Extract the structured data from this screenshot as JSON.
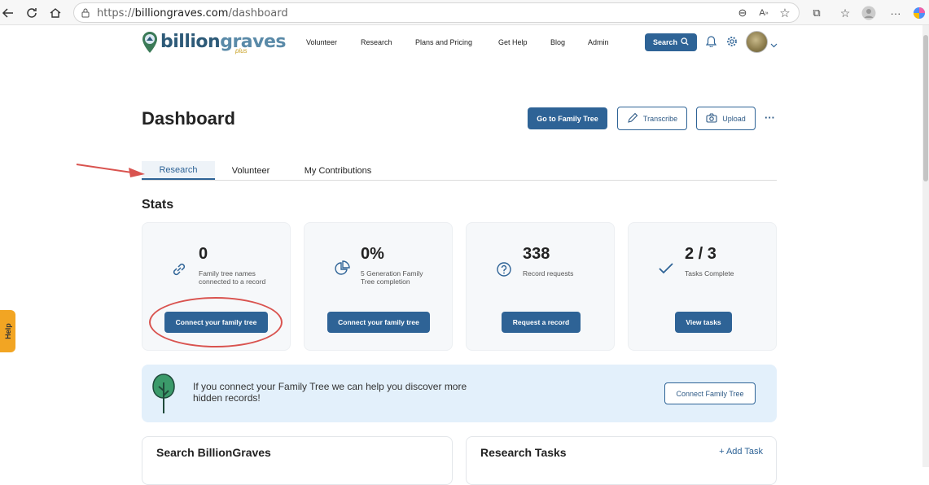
{
  "browser": {
    "url_prefix": "https://",
    "url_host": "billiongraves.com",
    "url_path": "/dashboard"
  },
  "site": {
    "logo_part1": "billion",
    "logo_part2": "graves",
    "logo_plus": "plus",
    "nav": [
      "Volunteer",
      "Research",
      "Plans and Pricing",
      "Get Help",
      "Blog",
      "Admin"
    ],
    "search_label": "Search"
  },
  "dashboard": {
    "title": "Dashboard",
    "go_to_family_tree": "Go to Family Tree",
    "transcribe": "Transcribe",
    "upload": "Upload",
    "more": "···"
  },
  "tabs": [
    "Research",
    "Volunteer",
    "My Contributions"
  ],
  "stats": {
    "title": "Stats",
    "cards": [
      {
        "value": "0",
        "label": "Family tree names connected to a record",
        "button": "Connect your family tree",
        "icon": "link-icon"
      },
      {
        "value": "0%",
        "label": "5 Generation Family Tree completion",
        "button": "Connect your family tree",
        "icon": "pie-chart-icon"
      },
      {
        "value": "338",
        "label": "Record requests",
        "button": "Request a record",
        "icon": "question-icon"
      },
      {
        "value": "2 / 3",
        "label": "Tasks Complete",
        "button": "View tasks",
        "icon": "check-icon"
      }
    ]
  },
  "banner": {
    "text": "If you connect your Family Tree we can help you discover more hidden records!",
    "button": "Connect Family Tree"
  },
  "panels": {
    "search_title": "Search BillionGraves",
    "tasks_title": "Research Tasks",
    "add_task": "+ Add Task"
  },
  "help_tab": "Help",
  "colors": {
    "primary": "#2e6396",
    "banner_bg": "#e3f0fb",
    "annotation": "#d9534f",
    "help_tab": "#f2a523"
  }
}
